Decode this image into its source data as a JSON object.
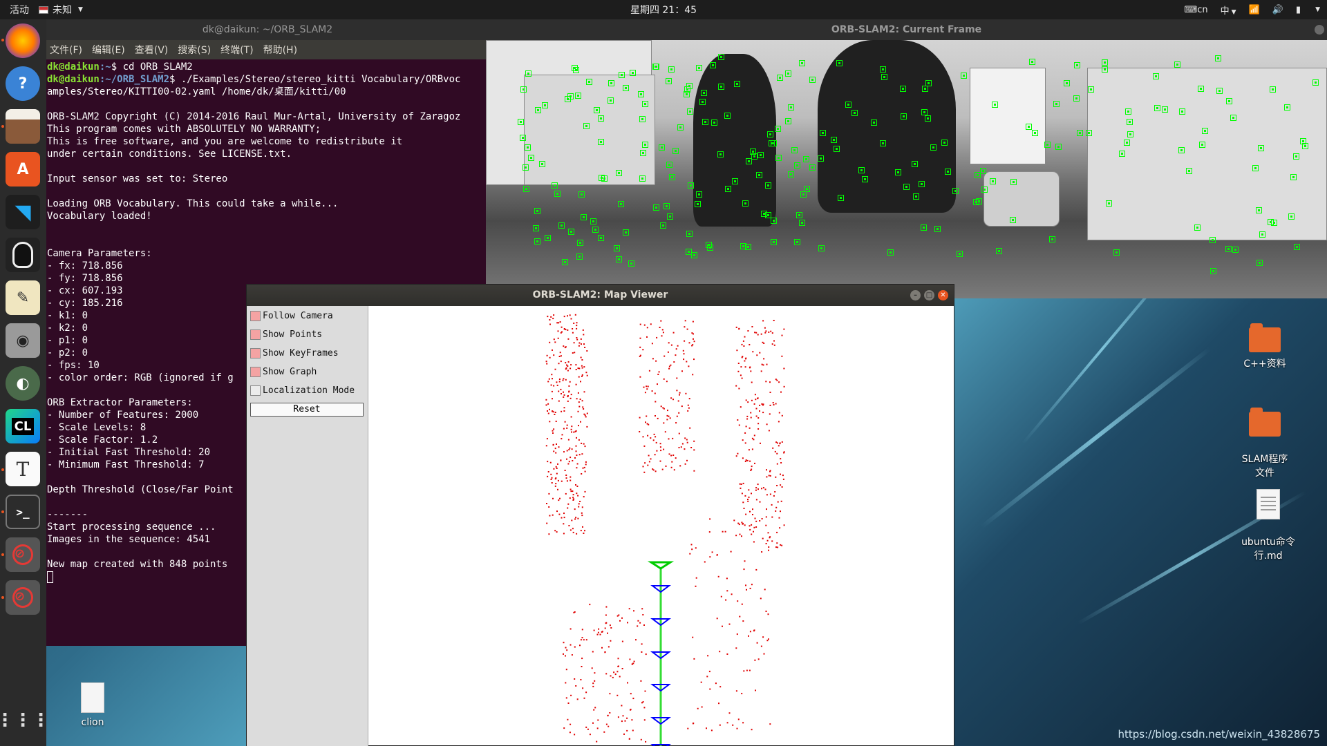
{
  "topbar": {
    "activities": "活动",
    "app_name": "未知",
    "clock": "星期四 21：45",
    "keyboard": "cn",
    "input_method": "中"
  },
  "dock": {
    "items": [
      {
        "name": "firefox",
        "color": "#e66000"
      },
      {
        "name": "help",
        "color": "#3a83d6"
      },
      {
        "name": "files",
        "color": "#8a5a3a"
      },
      {
        "name": "software",
        "color": "#e95420"
      },
      {
        "name": "vscode",
        "color": "#23a9f2"
      },
      {
        "name": "qq",
        "color": "#222222"
      },
      {
        "name": "text-editor",
        "color": "#f0e0a0"
      },
      {
        "name": "camera",
        "color": "#9a9a9a"
      },
      {
        "name": "eye-of-gnome",
        "color": "#4a8a4a"
      },
      {
        "name": "clion",
        "color": "#1b7f6f"
      },
      {
        "name": "typora",
        "color": "#ffffff"
      },
      {
        "name": "terminal",
        "color": "#333333"
      },
      {
        "name": "orb-slam-current-frame",
        "color": "#4a4a4a"
      },
      {
        "name": "orb-slam-map-viewer",
        "color": "#4a4a4a"
      }
    ],
    "labels": {
      "clion_label": "CL",
      "typora_label": "T",
      "terminal_label": ">_",
      "help_label": "?"
    }
  },
  "terminal": {
    "title": "dk@daikun: ~/ORB_SLAM2",
    "menu": [
      "文件(F)",
      "编辑(E)",
      "查看(V)",
      "搜索(S)",
      "终端(T)",
      "帮助(H)"
    ],
    "prompt1_user": "dk@daikun",
    "prompt1_path": ":~",
    "prompt1_cmd": "$ cd ORB_SLAM2",
    "prompt2_user": "dk@daikun",
    "prompt2_path": ":~/ORB_SLAM2",
    "prompt2_cmd": "$ ./Examples/Stereo/stereo_kitti Vocabulary/ORBvoc",
    "output": "amples/Stereo/KITTI00-02.yaml /home/dk/桌面/kitti/00\n\nORB-SLAM2 Copyright (C) 2014-2016 Raul Mur-Artal, University of Zaragoz\nThis program comes with ABSOLUTELY NO WARRANTY;\nThis is free software, and you are welcome to redistribute it\nunder certain conditions. See LICENSE.txt.\n\nInput sensor was set to: Stereo\n\nLoading ORB Vocabulary. This could take a while...\nVocabulary loaded!\n\n\nCamera Parameters:\n- fx: 718.856\n- fy: 718.856\n- cx: 607.193\n- cy: 185.216\n- k1: 0\n- k2: 0\n- p1: 0\n- p2: 0\n- fps: 10\n- color order: RGB (ignored if g\n\nORB Extractor Parameters:\n- Number of Features: 2000\n- Scale Levels: 8\n- Scale Factor: 1.2\n- Initial Fast Threshold: 20\n- Minimum Fast Threshold: 7\n\nDepth Threshold (Close/Far Point\n\n-------\nStart processing sequence ...\nImages in the sequence: 4541\n\nNew map created with 848 points"
  },
  "current_frame": {
    "title": "ORB-SLAM2: Current Frame"
  },
  "map_viewer": {
    "title": "ORB-SLAM2: Map Viewer",
    "options": [
      {
        "label": "Follow Camera",
        "checked": true
      },
      {
        "label": "Show Points",
        "checked": true
      },
      {
        "label": "Show KeyFrames",
        "checked": true
      },
      {
        "label": "Show Graph",
        "checked": true
      },
      {
        "label": "Localization Mode",
        "checked": false
      }
    ],
    "reset_label": "Reset",
    "colors": {
      "points": "#e00000",
      "keyframes": "#0000ff",
      "current_camera": "#00cc00",
      "graph": "#33dd33"
    }
  },
  "desktop": {
    "icons": [
      {
        "label": "C++资料",
        "type": "folder"
      },
      {
        "label": "SLAM程序\n文件",
        "type": "folder"
      },
      {
        "label": "ubuntu命令\n行.md",
        "type": "document"
      },
      {
        "label": "clion",
        "type": "document"
      }
    ]
  },
  "watermark": "https://blog.csdn.net/weixin_43828675"
}
